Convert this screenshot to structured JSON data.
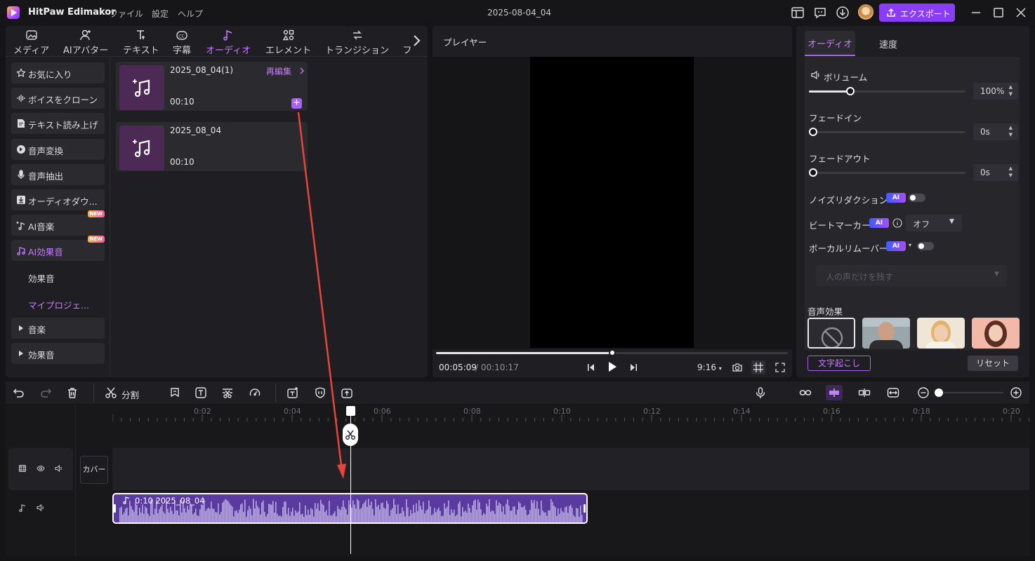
{
  "titlebar": {
    "app_name": "HitPaw Edimakor",
    "menus": [
      "ファイル",
      "設定",
      "ヘルプ"
    ],
    "project_title": "2025-08-04_04",
    "export_label": "エクスポート"
  },
  "left_tabs": [
    {
      "label": "メディア",
      "icon": "media-icon"
    },
    {
      "label": "AIアバター",
      "icon": "avatar-icon"
    },
    {
      "label": "テキスト",
      "icon": "text-icon"
    },
    {
      "label": "字幕",
      "icon": "caption-icon"
    },
    {
      "label": "オーディオ",
      "icon": "audio-note-icon",
      "active": true
    },
    {
      "label": "エレメント",
      "icon": "element-icon"
    },
    {
      "label": "トランジション",
      "icon": "transition-icon"
    },
    {
      "label": "フ",
      "icon": "filter-icon"
    }
  ],
  "categories": [
    {
      "label": "お気に入り",
      "icon": "star-icon"
    },
    {
      "label": "ボイスをクローン",
      "icon": "waveform-icon"
    },
    {
      "label": "テキスト読み上げ",
      "icon": "tts-icon"
    },
    {
      "label": "音声変換",
      "icon": "voice-change-icon"
    },
    {
      "label": "音声抽出",
      "icon": "microphone-icon"
    },
    {
      "label": "オーディオダウ...",
      "icon": "download-icon"
    },
    {
      "label": "AI音楽",
      "icon": "ai-music-icon",
      "badge": "NEW"
    },
    {
      "label": "AI効果音",
      "icon": "ai-sfx-icon",
      "badge": "NEW",
      "active": true
    }
  ],
  "subcategories": [
    {
      "label": "効果音"
    },
    {
      "label": "マイプロジェ...",
      "active": true
    }
  ],
  "folders": [
    {
      "label": "音楽"
    },
    {
      "label": "効果音"
    }
  ],
  "media_items": [
    {
      "name": "2025_08_04(1)",
      "duration": "00:10",
      "reedit": "再編集"
    },
    {
      "name": "2025_08_04",
      "duration": "00:10"
    }
  ],
  "player": {
    "title": "プレイヤー",
    "current_time": "00:05:09",
    "total_time": "/ 00:10:17",
    "progress": 0.5,
    "aspect": "9:16"
  },
  "right_panel": {
    "tabs": [
      "オーディオ",
      "速度"
    ],
    "volume_label": "ボリューム",
    "volume_value": "100%",
    "volume_level": 0.2,
    "fadein_label": "フェードイン",
    "fadein_value": "0s",
    "fadeout_label": "フェードアウト",
    "fadeout_value": "0s",
    "noise_label": "ノイズリダクション",
    "beat_label": "ビートマーカー",
    "beat_value": "オフ",
    "vocal_label": "ボーカルリムーバー",
    "vocal_placeholder": "人の声だけを残す",
    "ai_badge": "AI",
    "effects_label": "音声効果",
    "transcribe_label": "文字起こし",
    "reset_label": "リセット"
  },
  "timeline": {
    "split_label": "分割",
    "ticks": [
      "0:02",
      "0:04",
      "0:06",
      "0:08",
      "0:10",
      "0:12",
      "0:14",
      "0:16",
      "0:18",
      "0:20"
    ],
    "cover_label": "カバー",
    "clip_label": "0:10 2025_08_04"
  },
  "colors": {
    "accent": "#a960f5",
    "accent_text": "#c77dff",
    "annotation_arrow": "#e8443a"
  }
}
